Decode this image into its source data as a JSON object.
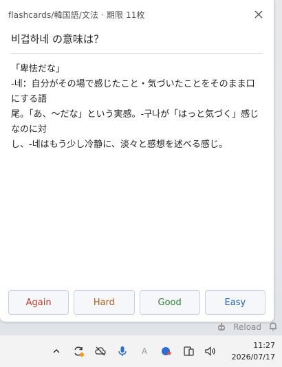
{
  "card": {
    "deck_line": "flashcards/韓国語/文法 · 期限 11枚",
    "question": "비겁하네 の意味は？",
    "answer_lines": [
      "「卑怯だな」",
      "-네：自分がその場で感じたこと・気づいたことをそのまま口にする語",
      "尾。「あ、〜だな」という実感。-구나が「はっと気づく」感じなのに対",
      "し、-네はもう少し冷静に、淡々と感想を述べる感じ。"
    ]
  },
  "buttons": {
    "again": "Again",
    "hard": "Hard",
    "good": "Good",
    "easy": "Easy"
  },
  "background": {
    "reload_label": "Reload"
  },
  "taskbar": {
    "time": "11:27",
    "date": "2026/07/17",
    "ime_label": "A"
  },
  "colors": {
    "again": "#c0392b",
    "hard": "#b55a17",
    "good": "#2e7d32",
    "easy": "#1e5fb8"
  }
}
